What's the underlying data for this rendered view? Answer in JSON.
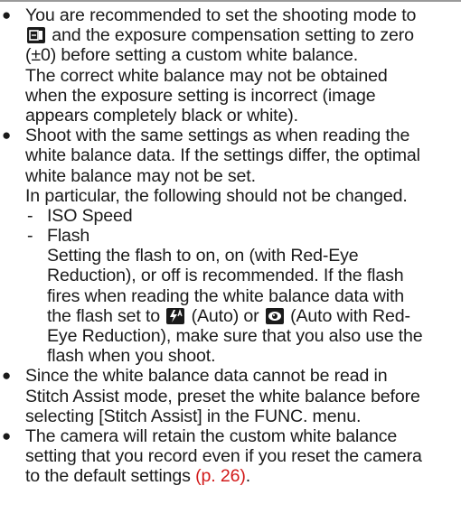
{
  "bullets": {
    "b1": {
      "symbol": "●",
      "l1": "You are recommended to set the shooting mode to",
      "l2b": "and the exposure compensation setting to zero",
      "l3": "(±0) before setting a custom white balance.",
      "l4": "The correct white balance may not be obtained",
      "l5": "when the exposure setting is incorrect (image",
      "l6": "appears completely black or white)."
    },
    "b2": {
      "symbol": "●",
      "l1": "Shoot with the same settings as when reading the",
      "l2": "white balance data. If the settings differ, the optimal",
      "l3": "white balance may not be set.",
      "l4": "In particular, the following should not be changed.",
      "sub1_dash": "-",
      "sub1": "ISO Speed",
      "sub2_dash": "-",
      "sub2": "Flash",
      "f1": "Setting the flash to on, on (with Red-Eye",
      "f2": "Reduction), or off is recommended. If the flash",
      "f3": "fires when reading the white balance data with",
      "f4a": "the flash set to",
      "f4b": "(Auto) or",
      "f4c": "(Auto with Red-",
      "f5": "Eye Reduction), make sure that you also use the",
      "f6": "flash when you shoot."
    },
    "b3": {
      "symbol": "●",
      "l1": "Since the white balance data cannot be read in",
      "l2": "Stitch Assist mode, preset the white balance before",
      "l3": "selecting [Stitch Assist] in the FUNC. menu."
    },
    "b4": {
      "symbol": "●",
      "l1": "The camera will retain the custom white balance",
      "l2": "setting that you record even if you reset the camera",
      "l3a": "to the default settings",
      "l3b": "(p. 26)",
      "l3c": "."
    }
  },
  "icons": {
    "manual_mode": "manual-shooting-mode-icon",
    "flash_auto": "flash-auto-icon",
    "red_eye_auto": "red-eye-auto-icon"
  },
  "colors": {
    "link": "#d21a1a",
    "icon_bg": "#1a1a1a",
    "rule": "#9a9a9a"
  }
}
